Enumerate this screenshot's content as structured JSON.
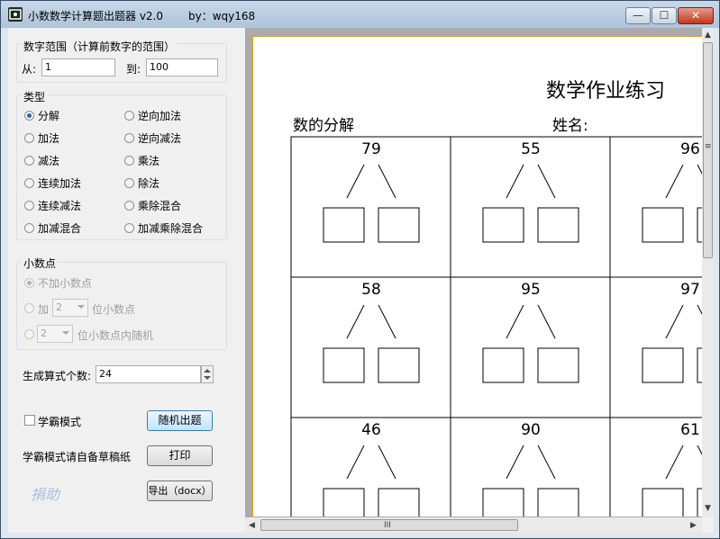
{
  "window": {
    "title": "小数数学计算题出题器 v2.0",
    "author": "by：wqy168",
    "min_glyph": "—",
    "max_glyph": "☐",
    "close_glyph": "✕"
  },
  "range": {
    "group_label": "数字范围（计算前数字的范围）",
    "from_label": "从:",
    "from_value": "1",
    "to_label": "到:",
    "to_value": "100"
  },
  "types": {
    "group_label": "类型",
    "options": [
      {
        "label": "分解",
        "selected": true
      },
      {
        "label": "逆向加法",
        "selected": false
      },
      {
        "label": "加法",
        "selected": false
      },
      {
        "label": "逆向减法",
        "selected": false
      },
      {
        "label": "减法",
        "selected": false
      },
      {
        "label": "乘法",
        "selected": false
      },
      {
        "label": "连续加法",
        "selected": false
      },
      {
        "label": "除法",
        "selected": false
      },
      {
        "label": "连续减法",
        "selected": false
      },
      {
        "label": "乘除混合",
        "selected": false
      },
      {
        "label": "加减混合",
        "selected": false
      },
      {
        "label": "加减乘除混合",
        "selected": false
      }
    ]
  },
  "decimal": {
    "group_label": "小数点",
    "no_decimal_label": "不加小数点",
    "add_prefix": "加",
    "add_select_value": "2",
    "add_suffix": "位小数点",
    "random_select_value": "2",
    "random_suffix": "位小数点内随机"
  },
  "count": {
    "label": "生成算式个数:",
    "value": "24"
  },
  "xueba": {
    "checkbox_label": "学霸模式",
    "note": "学霸模式请自备草稿纸"
  },
  "buttons": {
    "random": "随机出题",
    "print": "打印",
    "export": "导出（docx）"
  },
  "sponsor": "捐助",
  "preview": {
    "title": "数学作业练习",
    "subtitle": "数的分解",
    "name_label": "姓名:",
    "numbers": [
      "79",
      "55",
      "96",
      "58",
      "95",
      "97",
      "46",
      "90",
      "61"
    ],
    "scroll_hglyph": "III",
    "scroll_vglyph": "≡"
  },
  "colors": {
    "accent_border": "#d8a43a",
    "sponsor_text": "#a8c0e0",
    "close_button": "#c2381f"
  }
}
